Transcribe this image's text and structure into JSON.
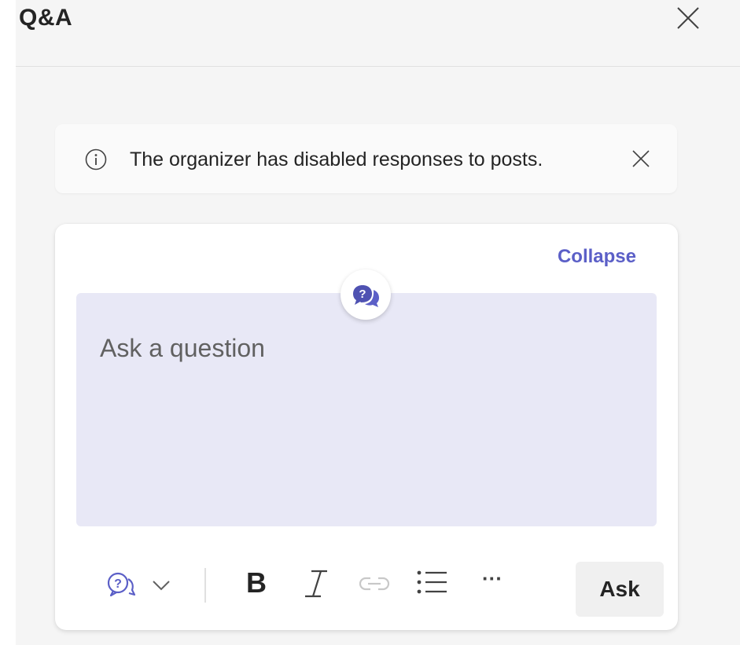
{
  "header": {
    "title": "Q&A"
  },
  "notice": {
    "text": "The organizer has disabled responses to posts."
  },
  "compose": {
    "collapse_label": "Collapse",
    "placeholder": "Ask a question",
    "toolbar": {
      "post_type_icon": "question-bubble-icon",
      "bold_label": "B",
      "italic_label": "I",
      "link_icon": "link-icon",
      "list_icon": "bullet-list-icon",
      "more_label": "···",
      "ask_label": "Ask"
    }
  },
  "colors": {
    "accent": "#5b5fc7",
    "input_background": "#e8e8f6",
    "panel_background": "#f5f5f5"
  }
}
